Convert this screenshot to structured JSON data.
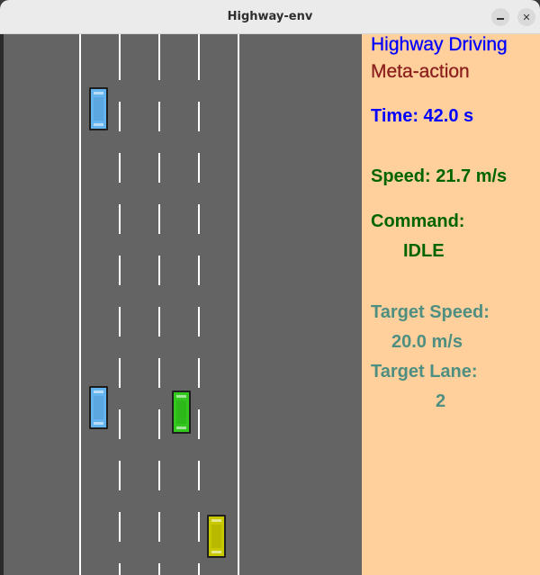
{
  "window": {
    "title": "Highway-env",
    "controls": {
      "minimize_icon": "minimize-icon",
      "close_icon": "close-icon",
      "close_glyph": "✕"
    }
  },
  "road": {
    "lanes": 4,
    "colors": {
      "asphalt": "#646464",
      "marking": "#ffffff"
    }
  },
  "vehicles": [
    {
      "name": "vehicle-blue-1",
      "color": "#64b4f0",
      "role": "other"
    },
    {
      "name": "vehicle-blue-2",
      "color": "#64b4f0",
      "role": "other"
    },
    {
      "name": "vehicle-green-ego",
      "color": "#32c81e",
      "role": "ego"
    },
    {
      "name": "vehicle-yellow",
      "color": "#c8c800",
      "role": "other"
    }
  ],
  "panel": {
    "background": "#ffd09b",
    "title": "Highway Driving",
    "subtitle": "Meta-action",
    "time": "Time: 42.0 s",
    "speed": "Speed: 21.7 m/s",
    "command_label": "Command:",
    "command_value": "IDLE",
    "target_speed_label": "Target Speed:",
    "target_speed_value": "20.0 m/s",
    "target_lane_label": "Target Lane:",
    "target_lane_value": "2"
  }
}
